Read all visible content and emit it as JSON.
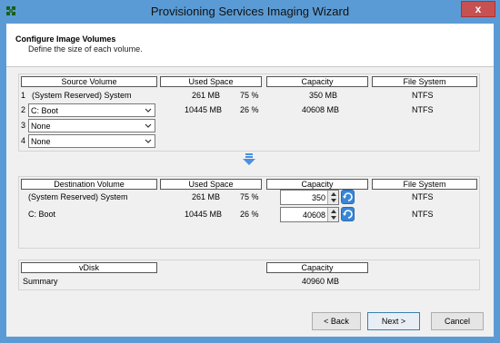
{
  "window": {
    "title": "Provisioning Services Imaging Wizard",
    "close_label": "x"
  },
  "header": {
    "title": "Configure Image Volumes",
    "subtitle": "Define the size of each volume."
  },
  "source": {
    "headers": {
      "volume": "Source Volume",
      "used": "Used Space",
      "capacity": "Capacity",
      "fs": "File System"
    },
    "rows": [
      {
        "num": "1",
        "volume": "(System Reserved)  System",
        "used": "261 MB",
        "pct": "75 %",
        "capacity": "350 MB",
        "fs": "NTFS"
      },
      {
        "num": "2",
        "volume": "C: Boot",
        "used": "10445 MB",
        "pct": "26 %",
        "capacity": "40608 MB",
        "fs": "NTFS"
      },
      {
        "num": "3",
        "volume": "None"
      },
      {
        "num": "4",
        "volume": "None"
      }
    ]
  },
  "destination": {
    "headers": {
      "volume": "Destination Volume",
      "used": "Used Space",
      "capacity": "Capacity",
      "fs": "File System"
    },
    "rows": [
      {
        "volume": "(System Reserved)  System",
        "used": "261 MB",
        "pct": "75 %",
        "capacity": "350",
        "fs": "NTFS"
      },
      {
        "volume": "C: Boot",
        "used": "10445 MB",
        "pct": "26 %",
        "capacity": "40608",
        "fs": "NTFS"
      }
    ]
  },
  "vdisk": {
    "headers": {
      "vdisk": "vDisk",
      "capacity": "Capacity"
    },
    "summary_label": "Summary",
    "summary_capacity": "40960 MB"
  },
  "buttons": {
    "back": "< Back",
    "next": "Next >",
    "cancel": "Cancel"
  },
  "colors": {
    "accent": "#5b9bd5",
    "close": "#c75050"
  },
  "icons": {
    "app": "app-icon",
    "arrow": "down-arrow-icon",
    "refresh": "refresh-icon"
  }
}
